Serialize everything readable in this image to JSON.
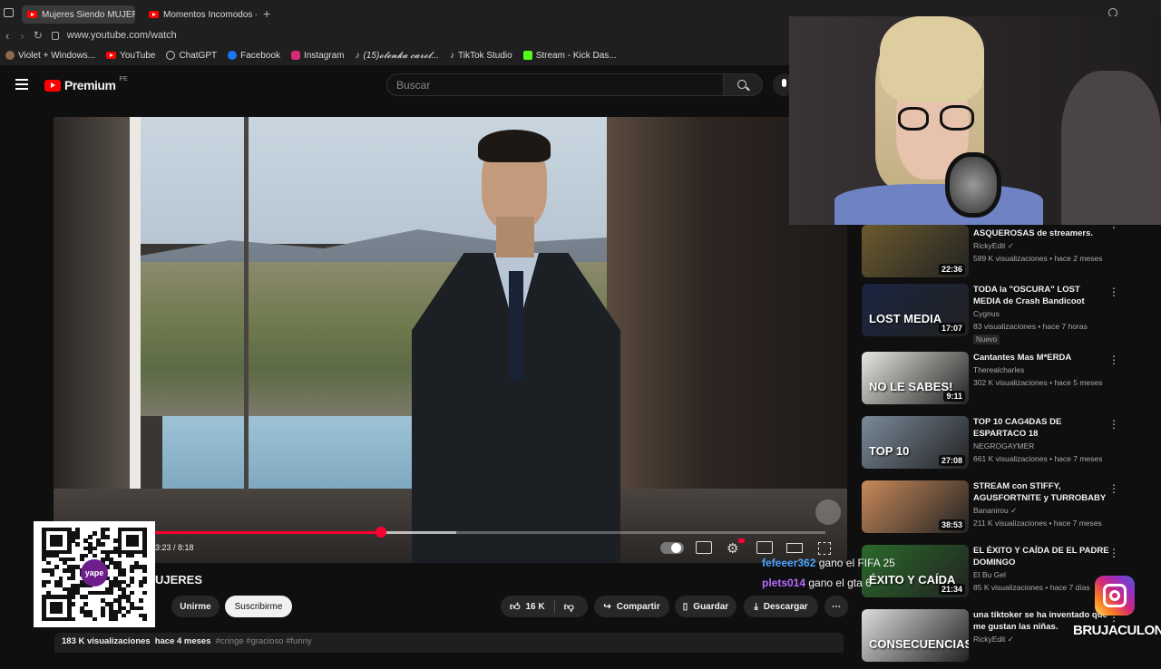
{
  "browser": {
    "tabs": [
      {
        "title": "Mujeres Siendo MUJERES",
        "active": true
      },
      {
        "title": "Momentos Incomodos - Y",
        "active": false
      }
    ],
    "new_tab": "+",
    "url": "www.youtube.com/watch",
    "bookmarks": [
      {
        "label": "Violet + Windows...",
        "color": "#8a6a4a"
      },
      {
        "label": "YouTube",
        "color": "#ff0000"
      },
      {
        "label": "ChatGPT",
        "color": "#cccccc"
      },
      {
        "label": "Facebook",
        "color": "#1877f2"
      },
      {
        "label": "Instagram",
        "color": "#d62976"
      },
      {
        "label": "(15)𝓸𝓵𝓮𝓷𝓴𝓪 𝓬𝓪𝓻𝓸𝓵...",
        "color": "#eeeeee"
      },
      {
        "label": "TikTok Studio",
        "color": "#eeeeee"
      },
      {
        "label": "Stream - Kick Das...",
        "color": "#53fc18"
      }
    ]
  },
  "header": {
    "logo_text": "Premium",
    "logo_sup": "PE",
    "search_placeholder": "Buscar"
  },
  "player": {
    "time": "3:23 / 8:18",
    "progress": 0.338,
    "buffered": 0.45
  },
  "video_info": {
    "title_fragment": "UJERES",
    "join_label": "Unirme",
    "subscribe_label": "Suscribirme",
    "likes": "16 K",
    "share_label": "Compartir",
    "save_label": "Guardar",
    "download_label": "Descargar",
    "views": "183 K visualizaciones",
    "age": "hace 4 meses",
    "hashtags": "#cringe #gracioso #funny"
  },
  "chat": [
    {
      "user": "fefeeer362",
      "message": "gano el FIFA 25",
      "color": "#4aa3ff"
    },
    {
      "user": "plets014",
      "message": "gano el gta 6",
      "color": "#b86bff"
    }
  ],
  "sidebar": {
    "items": [
      {
        "title": "las habitaciones MAS ASQUEROSAS de streamers.",
        "channel": "RickyEdit",
        "verified": true,
        "meta": "589 K visualizaciones • hace 2 meses",
        "duration": "22:36",
        "thumb_color": "#6b5a2e"
      },
      {
        "title": "TODA la \"OSCURA\" LOST MEDIA de Crash Bandicoot",
        "channel": "Cygnus",
        "verified": false,
        "meta": "83 visualizaciones • hace 7 horas",
        "badge": "Nuevo",
        "duration": "17:07",
        "thumb_text": "LOST MEDIA",
        "thumb_color": "#1a2440"
      },
      {
        "title": "Cantantes Mas M*ERDA",
        "channel": "Therealcharles",
        "verified": false,
        "meta": "302 K visualizaciones • hace 5 meses",
        "duration": "9:11",
        "thumb_text": "NO LE SABES!",
        "thumb_color": "#e8e6e0"
      },
      {
        "title": "TOP 10 CAG4DAS DE ESPARTACO 18",
        "channel": "NEGROGAYMER",
        "verified": false,
        "meta": "661 K visualizaciones • hace 7 meses",
        "duration": "27:08",
        "thumb_text": "TOP 10",
        "thumb_color": "#7a8a9a"
      },
      {
        "title": "STREAM con STIFFY, AGUSFORTNITE y TURROBABY",
        "channel": "Bananirou",
        "verified": true,
        "meta": "211 K visualizaciones • hace 7 meses",
        "duration": "38:53",
        "thumb_color": "#c98a5a"
      },
      {
        "title": "EL ÉXITO Y CAÍDA DE EL PADRE DOMINGO",
        "channel": "El Bu Gel",
        "verified": false,
        "meta": "85 K visualizaciones • hace 7 días",
        "duration": "21:34",
        "thumb_text": "ÉXITO Y CAÍDA",
        "thumb_color": "#2a6a2a"
      },
      {
        "title": "una tiktoker se ha inventado que me gustan las niñas.",
        "channel": "RickyEdit",
        "verified": true,
        "meta": "",
        "duration": "",
        "thumb_text": "CONSECUENCIAS",
        "thumb_color": "#dddddd"
      }
    ]
  },
  "overlay": {
    "streamer_name": "BRUJACULONA",
    "qr_brand": "yape"
  }
}
